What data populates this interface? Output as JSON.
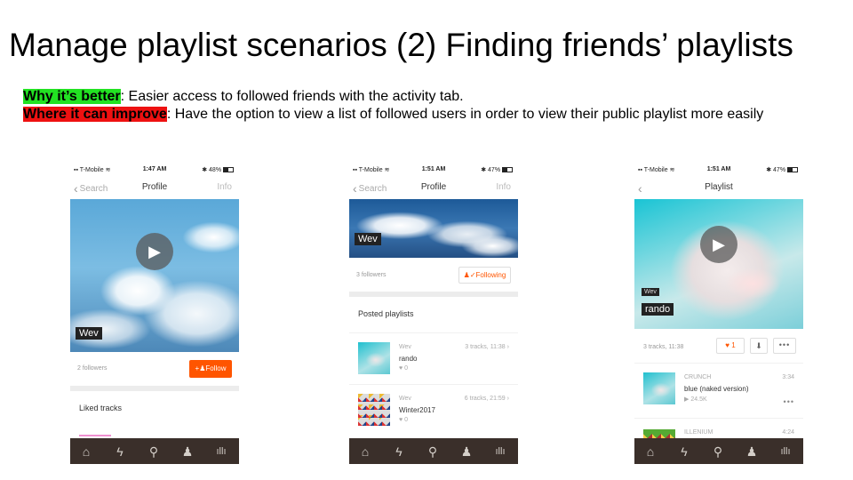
{
  "slide": {
    "title": "Manage playlist scenarios (2) Finding friends’ playlists",
    "why_label": "Why it’s better",
    "why_text": ": Easier access to followed friends with the activity tab.",
    "improve_label": "Where it can improve",
    "improve_text": ": Have the option to view a list of followed users in order to view their public playlist more easily"
  },
  "colors": {
    "accent": "#ff5500",
    "highlight_green": "#22e222",
    "highlight_red": "#ee1111",
    "tabbar": "#3a2f2a"
  },
  "tabbar_icons": [
    "home-icon",
    "lightning-icon",
    "search-icon",
    "user-icon",
    "library-icon"
  ],
  "phone1": {
    "status": {
      "carrier": "T-Mobile",
      "time": "1:47 AM",
      "battery": "48%"
    },
    "nav": {
      "back": "Search",
      "title": "Profile",
      "info": "Info"
    },
    "profile_name": "Wev",
    "followers": "2 followers",
    "follow_button": "Follow",
    "section_title": "Liked tracks"
  },
  "phone2": {
    "status": {
      "carrier": "T-Mobile",
      "time": "1:51 AM",
      "battery": "47%"
    },
    "nav": {
      "back": "Search",
      "title": "Profile",
      "info": "Info"
    },
    "profile_name": "Wev",
    "followers": "3 followers",
    "following_button": "Following",
    "section_title": "Posted playlists",
    "playlists": [
      {
        "user": "Wev",
        "title": "rando",
        "tracks": "3 tracks, 11:38",
        "likes": "0"
      },
      {
        "user": "Wev",
        "title": "Winter2017",
        "tracks": "6 tracks, 21:59",
        "likes": "0"
      }
    ]
  },
  "phone3": {
    "status": {
      "carrier": "T-Mobile",
      "time": "1:51 AM",
      "battery": "47%"
    },
    "nav": {
      "title": "Playlist"
    },
    "owner": "Wev",
    "playlist_title": "rando",
    "tracks_info": "3 tracks, 11:38",
    "like_count": "1",
    "tracks": [
      {
        "artist": "CRUNCH",
        "title": "blue (naked version)",
        "plays": "24.5K",
        "duration": "3:34"
      },
      {
        "artist": "ILLENIUM",
        "title": "",
        "plays": "",
        "duration": "4:24"
      }
    ]
  }
}
